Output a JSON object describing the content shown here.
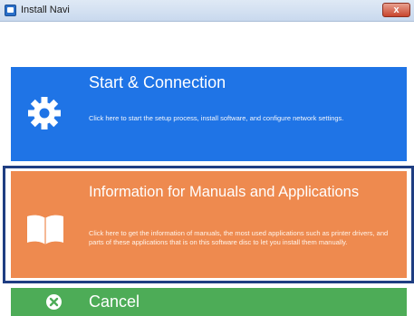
{
  "window": {
    "title": "Install Navi",
    "close_glyph": "x"
  },
  "menu": {
    "start": {
      "title": "Start & Connection",
      "description": "Click here to start the setup process, install software, and configure network settings.",
      "icon": "gear-icon",
      "color": "#1f74e6"
    },
    "info": {
      "title": "Information for Manuals and Applications",
      "description": "Click here to get the information of manuals, the most used applications such as printer drivers, and parts of these applications that is on this software disc to let you install them manually.",
      "icon": "book-icon",
      "color": "#ee8a4f",
      "selected": true
    },
    "cancel": {
      "label": "Cancel",
      "icon": "cancel-icon",
      "color": "#4dac57"
    }
  }
}
